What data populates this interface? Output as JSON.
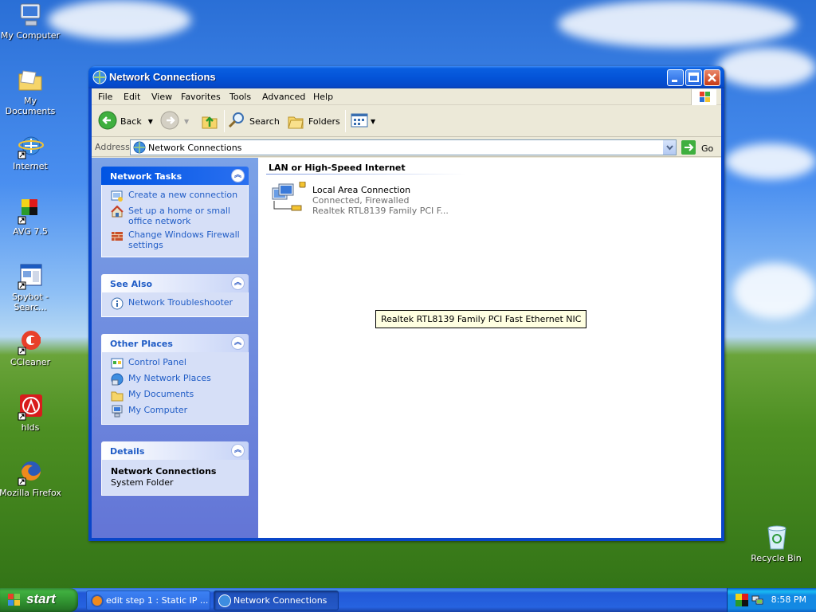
{
  "desktop": {
    "icons": [
      {
        "label": "My Computer"
      },
      {
        "label": "My Documents"
      },
      {
        "label": "Internet"
      },
      {
        "label": "AVG 7.5"
      },
      {
        "label": "Spybot - Searc..."
      },
      {
        "label": "CCleaner"
      },
      {
        "label": "hlds"
      },
      {
        "label": "Mozilla Firefox"
      },
      {
        "label": "Recycle Bin"
      }
    ]
  },
  "window": {
    "title": "Network Connections",
    "menu": [
      "File",
      "Edit",
      "View",
      "Favorites",
      "Tools",
      "Advanced",
      "Help"
    ],
    "toolbar": {
      "back": "Back",
      "search": "Search",
      "folders": "Folders"
    },
    "address": {
      "label": "Address",
      "value": "Network Connections",
      "go": "Go"
    }
  },
  "taskpane": {
    "network_tasks": {
      "title": "Network Tasks",
      "items": [
        "Create a new connection",
        "Set up a home or small office network",
        "Change Windows Firewall settings"
      ]
    },
    "see_also": {
      "title": "See Also",
      "items": [
        "Network Troubleshooter"
      ]
    },
    "other_places": {
      "title": "Other Places",
      "items": [
        "Control Panel",
        "My Network Places",
        "My Documents",
        "My Computer"
      ]
    },
    "details": {
      "title": "Details",
      "name": "Network Connections",
      "type": "System Folder"
    }
  },
  "main": {
    "group_title": "LAN or High-Speed Internet",
    "connection": {
      "name": "Local Area Connection",
      "status": "Connected, Firewalled",
      "device": "Realtek RTL8139 Family PCI F..."
    },
    "tooltip": "Realtek RTL8139 Family PCI Fast Ethernet NIC"
  },
  "taskbar": {
    "start": "start",
    "buttons": [
      "edit step 1 : Static IP ...",
      "Network Connections"
    ],
    "clock": "8:58 PM"
  }
}
